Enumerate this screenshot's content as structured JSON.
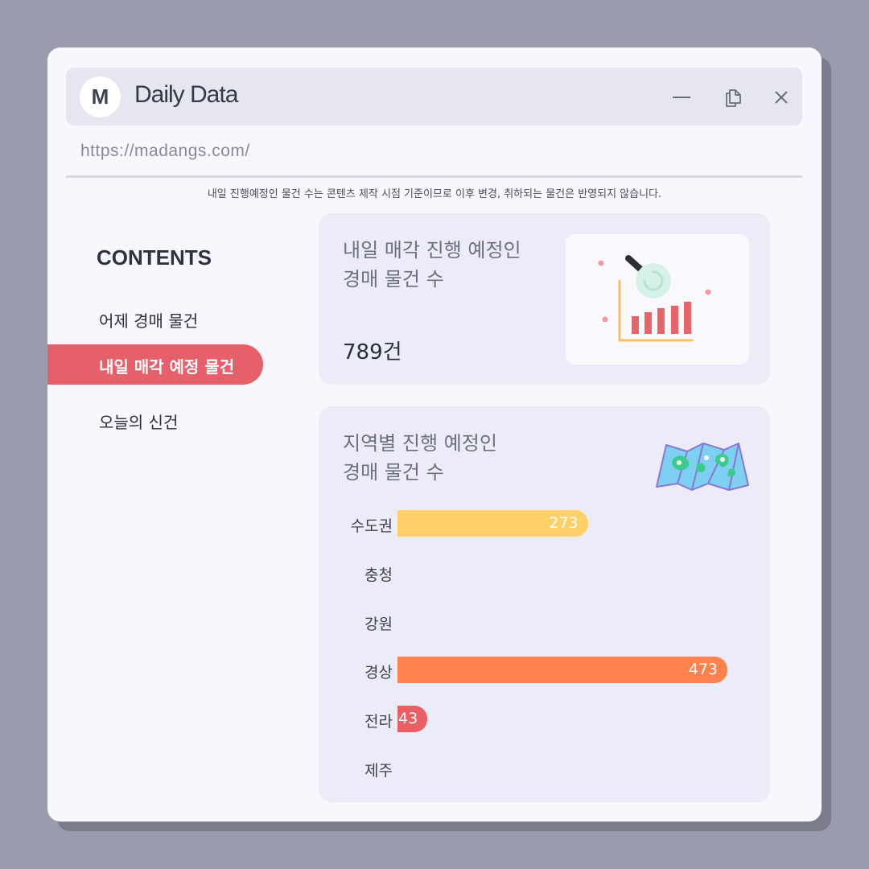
{
  "window": {
    "logo_letter": "M",
    "title": "Daily Data",
    "url": "https://madangs.com/",
    "notice": "내일 진행예정인 물건 수는 콘텐츠 제작 시점 기준이므로 이후 변경, 취하되는 물건은 반영되지 않습니다."
  },
  "sidebar": {
    "heading": "CONTENTS",
    "items": [
      {
        "label": "어제 경매 물건",
        "active": false
      },
      {
        "label": "내일 매각 예정 물건",
        "active": true
      },
      {
        "label": "오늘의 신건",
        "active": false
      }
    ]
  },
  "summary_card": {
    "title_line1": "내일 매각 진행 예정인",
    "title_line2": "경매 물건 수",
    "count": "789건",
    "icon": "bar-chart-magnifier-icon"
  },
  "region_card": {
    "title_line1": "지역별 진행 예정인",
    "title_line2": "경매 물건 수",
    "icon": "folded-map-icon"
  },
  "chart_data": {
    "type": "bar",
    "orientation": "horizontal",
    "categories": [
      "수도권",
      "충청",
      "강원",
      "경상",
      "전라",
      "제주"
    ],
    "values": [
      273,
      null,
      null,
      473,
      43,
      null
    ],
    "value_labels": [
      "273",
      "",
      "",
      "473",
      "43",
      ""
    ],
    "colors": [
      "#ffd068",
      null,
      null,
      "#ff824d",
      "#ea5e66",
      null
    ]
  },
  "colors": {
    "accent": "#e5606a",
    "background": "#9a9bac",
    "card": "#ecebf8"
  }
}
